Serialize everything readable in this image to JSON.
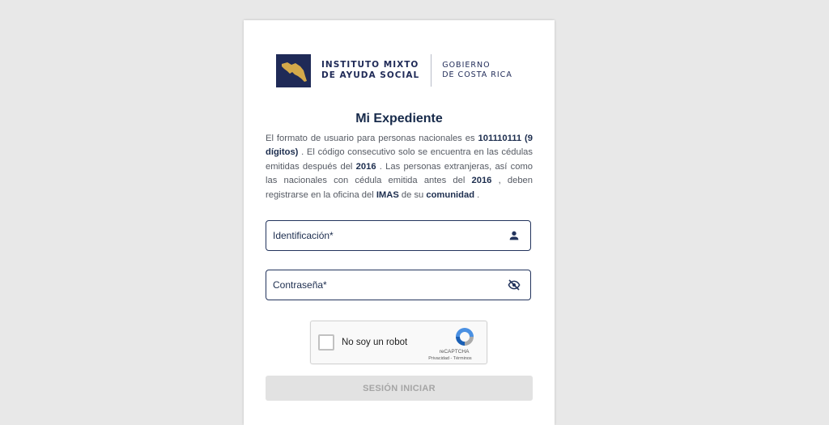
{
  "header": {
    "org_line1": "INSTITUTO MIXTO",
    "org_line2": "DE AYUDA SOCIAL",
    "gov_line1": "GOBIERNO",
    "gov_line2": "DE COSTA RICA"
  },
  "title": "Mi Expediente",
  "description": {
    "t1": "El formato de usuario para personas nacionales es ",
    "b1": "101110111 (9 dígitos)",
    "t2": " . El código consecutivo solo se encuentra en las cédulas emitidas después del ",
    "b2": "2016",
    "t3": " . Las personas extranjeras, así como las nacionales con cédula emitida antes del ",
    "b3": "2016",
    "t4": " , deben registrarse en la oficina del ",
    "b4": "IMAS",
    "t5": " de su ",
    "b5": "comunidad",
    "t6": " ."
  },
  "form": {
    "id_label": "Identificación*",
    "id_value": "",
    "password_label": "Contraseña*",
    "password_value": "",
    "id_icon": "person-icon",
    "password_icon": "eye-off-icon"
  },
  "captcha": {
    "label": "No soy un robot",
    "brand": "reCAPTCHA",
    "terms": "Privacidad - Términos",
    "checked": false
  },
  "submit_label": "SESIÓN INICIAR",
  "colors": {
    "brand_navy": "#1f2a57",
    "accent_gold": "#d4a94a",
    "background": "#e8e8e8",
    "disabled_button": "#e2e2e2"
  }
}
